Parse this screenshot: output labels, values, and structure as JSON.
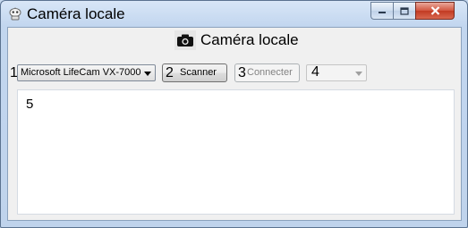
{
  "window": {
    "title": "Caméra locale",
    "app_icon": "robot-app-icon",
    "buttons": {
      "minimize_icon": "minimize-icon",
      "maximize_icon": "maximize-icon",
      "close_icon": "close-icon"
    }
  },
  "header": {
    "icon": "camera-icon",
    "title": "Caméra locale"
  },
  "toolbar": {
    "marker_1": "1",
    "camera_select": {
      "value": "Microsoft LifeCam VX-7000"
    },
    "scanner": {
      "number": "2",
      "label": "Scanner"
    },
    "connect": {
      "number": "3",
      "label": "Connecter",
      "enabled": false
    },
    "resolution_select": {
      "value": "4",
      "enabled": false
    }
  },
  "content": {
    "text": "5"
  },
  "colors": {
    "title_bar": "#c2d6ef",
    "client_bg": "#f0f0f0",
    "close_button": "#c23a22"
  }
}
